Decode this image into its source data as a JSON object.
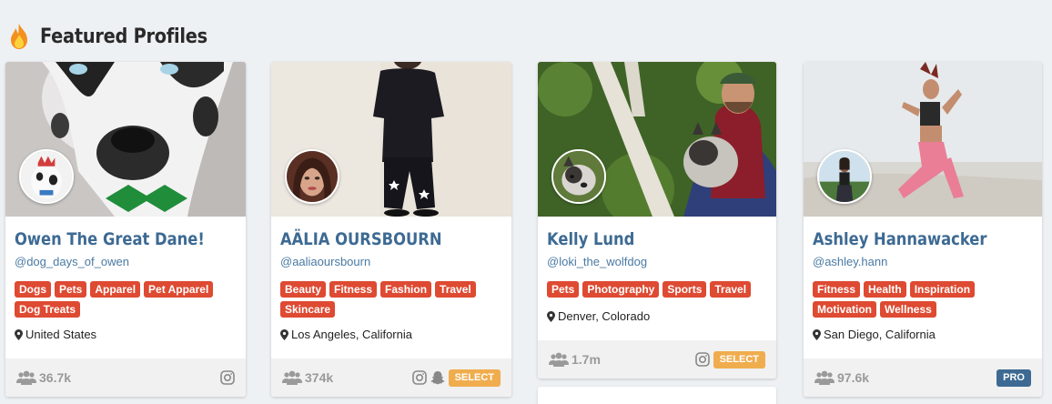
{
  "header": {
    "title": "Featured Profiles",
    "icon": "fire-icon"
  },
  "colors": {
    "name": "#3d6a93",
    "handle": "#4a7aa3",
    "tag": "#de4a32",
    "select_badge": "#f0ad4e",
    "pro_badge": "#3d6a93"
  },
  "profiles": [
    {
      "name": "Owen The Great Dane!",
      "handle": "@dog_days_of_owen",
      "tags": [
        "Dogs",
        "Pets",
        "Apparel",
        "Pet Apparel",
        "Dog Treats"
      ],
      "location": "United States",
      "followers": "36.7k",
      "platforms": [
        "instagram-icon"
      ]
    },
    {
      "name": "AÄLIA OURSBOURN",
      "handle": "@aaliaoursbourn",
      "tags": [
        "Beauty",
        "Fitness",
        "Fashion",
        "Travel",
        "Skincare"
      ],
      "location": "Los Angeles, California",
      "followers": "374k",
      "platforms": [
        "instagram-icon",
        "snapchat-icon"
      ],
      "badge": "SELECT"
    },
    {
      "name": "Kelly Lund",
      "handle": "@loki_the_wolfdog",
      "tags": [
        "Pets",
        "Photography",
        "Sports",
        "Travel"
      ],
      "location": "Denver, Colorado",
      "followers": "1.7m",
      "platforms": [
        "instagram-icon"
      ],
      "badge": "SELECT"
    },
    {
      "name": "Ashley Hannawacker",
      "handle": "@ashley.hann",
      "tags": [
        "Fitness",
        "Health",
        "Inspiration",
        "Motivation",
        "Wellness"
      ],
      "location": "San Diego, California",
      "followers": "97.6k",
      "badge": "PRO"
    }
  ]
}
